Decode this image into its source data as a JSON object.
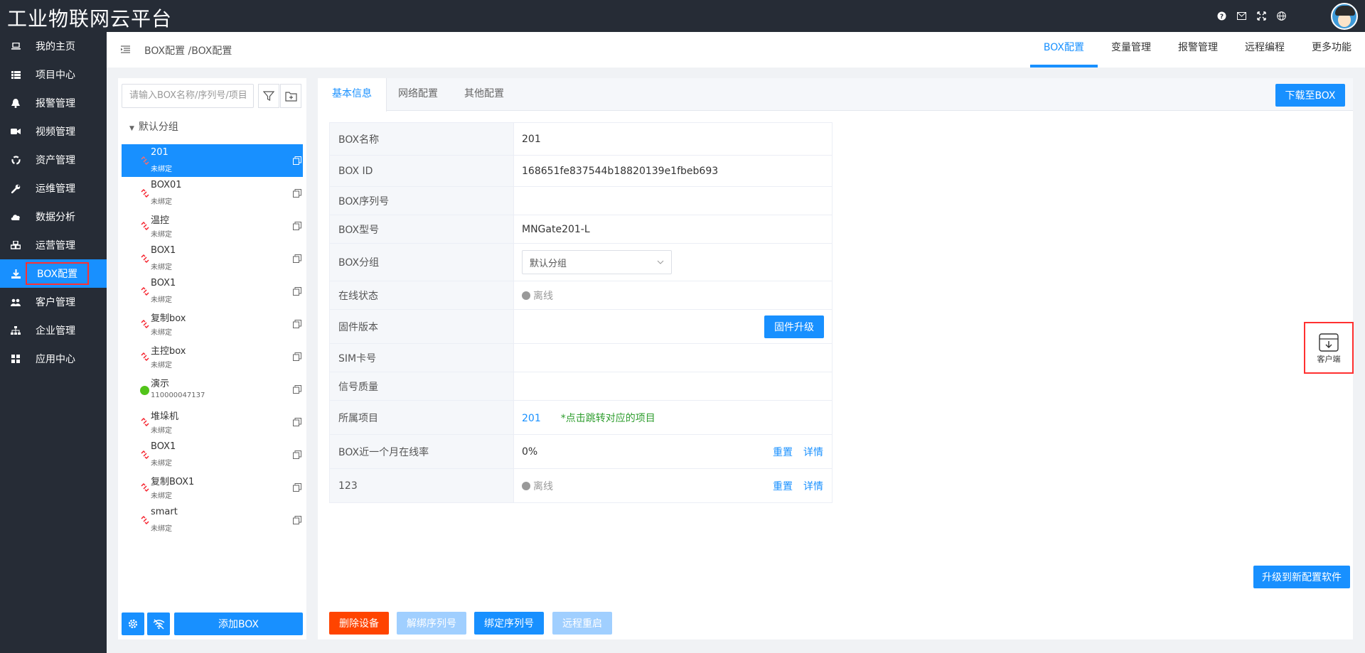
{
  "app": {
    "title": "工业物联网云平台"
  },
  "sidebar": {
    "items": [
      {
        "label": "我的主页",
        "icon": "laptop-icon"
      },
      {
        "label": "项目中心",
        "icon": "list-icon"
      },
      {
        "label": "报警管理",
        "icon": "bell-icon"
      },
      {
        "label": "视频管理",
        "icon": "video-icon"
      },
      {
        "label": "资产管理",
        "icon": "recycle-icon"
      },
      {
        "label": "运维管理",
        "icon": "wrench-icon"
      },
      {
        "label": "数据分析",
        "icon": "cloud-icon"
      },
      {
        "label": "运营管理",
        "icon": "cubes-icon"
      },
      {
        "label": "BOX配置",
        "icon": "download-icon",
        "active": true
      },
      {
        "label": "客户管理",
        "icon": "users-icon"
      },
      {
        "label": "企业管理",
        "icon": "sitemap-icon"
      },
      {
        "label": "应用中心",
        "icon": "apps-icon"
      }
    ]
  },
  "header": {
    "breadcrumb": "BOX配置 /BOX配置",
    "tabs": [
      "BOX配置",
      "变量管理",
      "报警管理",
      "远程编程",
      "更多功能"
    ]
  },
  "left": {
    "search_placeholder": "请输入BOX名称/序列号/项目",
    "group": "默认分组",
    "boxes": [
      {
        "name": "201",
        "status": "未绑定"
      },
      {
        "name": "BOX01",
        "status": "未绑定"
      },
      {
        "name": "温控",
        "status": "未绑定"
      },
      {
        "name": "BOX1",
        "status": "未绑定"
      },
      {
        "name": "BOX1",
        "status": "未绑定"
      },
      {
        "name": "复制box",
        "status": "未绑定"
      },
      {
        "name": "主控box",
        "status": "未绑定"
      },
      {
        "name": "演示",
        "status": "110000047137"
      },
      {
        "name": "堆垛机",
        "status": "未绑定"
      },
      {
        "name": "BOX1",
        "status": "未绑定"
      },
      {
        "name": "复制BOX1",
        "status": "未绑定"
      },
      {
        "name": "smart",
        "status": "未绑定"
      }
    ],
    "add_label": "添加BOX"
  },
  "main": {
    "tabs": [
      "基本信息",
      "网络配置",
      "其他配置"
    ],
    "download_label": "下载至BOX",
    "rows": {
      "name": {
        "label": "BOX名称",
        "value": "201"
      },
      "id": {
        "label": "BOX ID",
        "value": "168651fe837544b18820139e1fbeb693"
      },
      "serial": {
        "label": "BOX序列号",
        "value": ""
      },
      "model": {
        "label": "BOX型号",
        "value": "MNGate201-L"
      },
      "group": {
        "label": "BOX分组",
        "value": "默认分组"
      },
      "status": {
        "label": "在线状态",
        "value": "离线"
      },
      "firmware": {
        "label": "固件版本",
        "button": "固件升级"
      },
      "sim": {
        "label": "SIM卡号",
        "value": ""
      },
      "signal": {
        "label": "信号质量",
        "value": ""
      },
      "project": {
        "label": "所属项目",
        "value": "201",
        "hint": "*点击跳转对应的项目"
      },
      "rate": {
        "label": "BOX近一个月在线率",
        "value": "0%",
        "reset": "重置",
        "detail": "详情"
      },
      "r123": {
        "label": "123",
        "value": "离线",
        "reset": "重置",
        "detail": "详情"
      }
    },
    "upgrade_label": "升级到新配置软件",
    "buttons": {
      "delete": "删除设备",
      "unbind": "解绑序列号",
      "bind": "绑定序列号",
      "reboot": "远程重启"
    },
    "client_label": "客户端"
  },
  "colors": {
    "accent": "#1890ff",
    "danger": "#ff4400",
    "sidebar": "#262c36",
    "highlight": "#ff3030"
  }
}
